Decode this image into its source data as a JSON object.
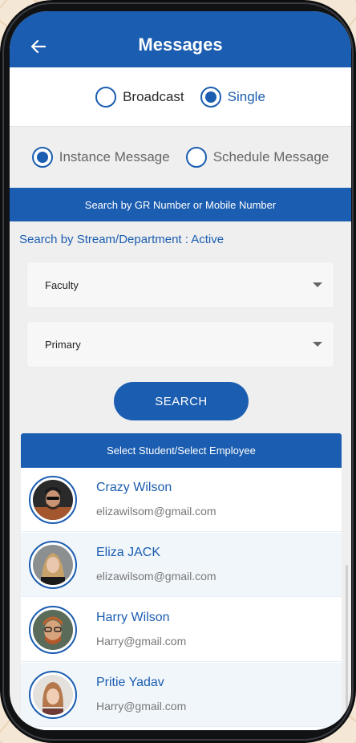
{
  "header": {
    "title": "Messages"
  },
  "audience": {
    "options": [
      {
        "label": "Broadcast",
        "selected": false
      },
      {
        "label": "Single",
        "selected": true
      }
    ]
  },
  "message_type": {
    "options": [
      {
        "label": "Instance Message",
        "selected": true
      },
      {
        "label": "Schedule Message",
        "selected": false
      }
    ]
  },
  "search_by_label": "Search by GR Number or Mobile Number",
  "stream_label": "Search by Stream/Department : Active",
  "filters": {
    "department": "Faculty",
    "stream": "Primary"
  },
  "search_button": "SEARCH",
  "list": {
    "header": "Select Student/Select Employee",
    "items": [
      {
        "name": "Crazy Wilson",
        "email": "elizawilsom@gmail.com"
      },
      {
        "name": "Eliza JACK",
        "email": "elizawilsom@gmail.com"
      },
      {
        "name": "Harry Wilson",
        "email": "Harry@gmail.com"
      },
      {
        "name": "Pritie Yadav",
        "email": "Harry@gmail.com"
      }
    ]
  },
  "colors": {
    "primary": "#1b5db0",
    "background": "#efefef"
  }
}
